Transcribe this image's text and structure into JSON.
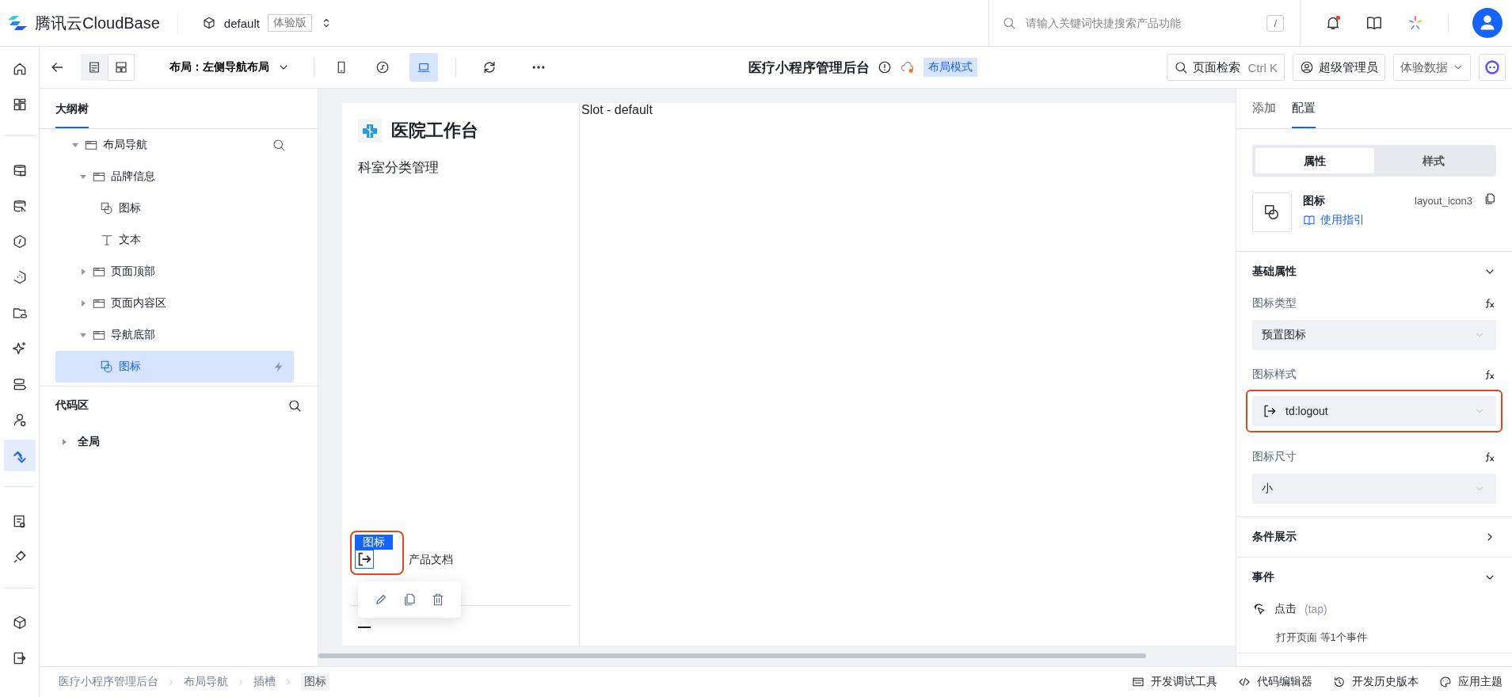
{
  "header": {
    "brand": "腾讯云CloudBase",
    "env": "default",
    "env_badge": "体验版",
    "search": {
      "placeholder": "请输入关键词快捷搜索产品功能",
      "shortcut": "/"
    },
    "notifications_unread": true
  },
  "rail": {
    "groups": [
      [
        {
          "selected": false
        },
        {
          "selected": false
        }
      ],
      [
        {
          "selected": false
        },
        {
          "selected": false
        },
        {
          "selected": false
        },
        {
          "selected": false
        },
        {
          "selected": false
        },
        {
          "selected": false
        },
        {
          "selected": false
        },
        {
          "selected": false
        },
        {
          "selected": true
        }
      ],
      [
        {
          "selected": false
        },
        {
          "selected": false
        }
      ],
      [
        {
          "selected": false
        },
        {
          "selected": false
        }
      ]
    ]
  },
  "toolbar": {
    "views": [
      {
        "selected": true
      },
      {
        "selected": false
      }
    ],
    "layout": "布局：左侧导航布局",
    "devices": [
      {
        "selected": false
      },
      {
        "selected": false
      },
      {
        "selected": true
      }
    ],
    "page_title": "医疗小程序管理后台",
    "mode_badge": "布局模式",
    "page_search": "页面检索",
    "page_search_shortcut": "Ctrl K",
    "role": "超级管理员",
    "data_source": "体验数据"
  },
  "outline": {
    "tab": "大纲树",
    "tree": [
      {
        "label": "布局导航",
        "kind": "container",
        "expanded": true,
        "selected": false,
        "children": [
          {
            "label": "品牌信息",
            "kind": "container",
            "expanded": true,
            "selected": false,
            "children": [
              {
                "label": "图标",
                "kind": "icon",
                "selected": false
              },
              {
                "label": "文本",
                "kind": "text",
                "selected": false
              }
            ]
          },
          {
            "label": "页面顶部",
            "kind": "container",
            "expanded": false,
            "selected": false
          },
          {
            "label": "页面内容区",
            "kind": "container",
            "expanded": false,
            "selected": false
          },
          {
            "label": "导航底部",
            "kind": "container",
            "expanded": true,
            "selected": false,
            "children": [
              {
                "label": "图标",
                "kind": "icon",
                "selected": true
              }
            ]
          }
        ]
      }
    ],
    "code_title": "代码区",
    "code_tree": [
      {
        "label": "全局",
        "expanded": false
      }
    ]
  },
  "canvas": {
    "brand_title": "医院工作台",
    "menu_item": "科室分类管理",
    "slot": "Slot - default",
    "selected_tag": "图标",
    "footer_link": "产品文档",
    "highlighted": true
  },
  "config": {
    "tabs": [
      {
        "label": "添加",
        "selected": false
      },
      {
        "label": "配置",
        "selected": true
      }
    ],
    "modes": [
      {
        "label": "属性",
        "selected": true
      },
      {
        "label": "样式",
        "selected": false
      }
    ],
    "component": {
      "name": "图标",
      "guide": "使用指引",
      "id": "layout_icon3"
    },
    "sections": [
      {
        "title": "基础属性",
        "expanded": true,
        "fields": [
          {
            "label": "图标类型",
            "value": "预置图标",
            "kind": "plain",
            "highlighted": false
          },
          {
            "label": "图标样式",
            "value": "td:logout",
            "kind": "icon",
            "highlighted": true
          },
          {
            "label": "图标尺寸",
            "value": "小",
            "kind": "plain",
            "highlighted": false
          }
        ]
      },
      {
        "title": "条件展示",
        "expanded": false
      },
      {
        "title": "事件",
        "expanded": true,
        "events": [
          {
            "name": "点击",
            "trigger": "(tap)",
            "summary": "打开页面 等1个事件"
          }
        ]
      }
    ]
  },
  "breadcrumb": [
    {
      "label": "医疗小程序管理后台",
      "selected": false
    },
    {
      "label": "布局导航",
      "selected": false
    },
    {
      "label": "插槽",
      "selected": false
    },
    {
      "label": "图标",
      "selected": true
    }
  ],
  "bottom_tools": [
    "开发调试工具",
    "代码编辑器",
    "开发历史版本",
    "应用主题"
  ]
}
